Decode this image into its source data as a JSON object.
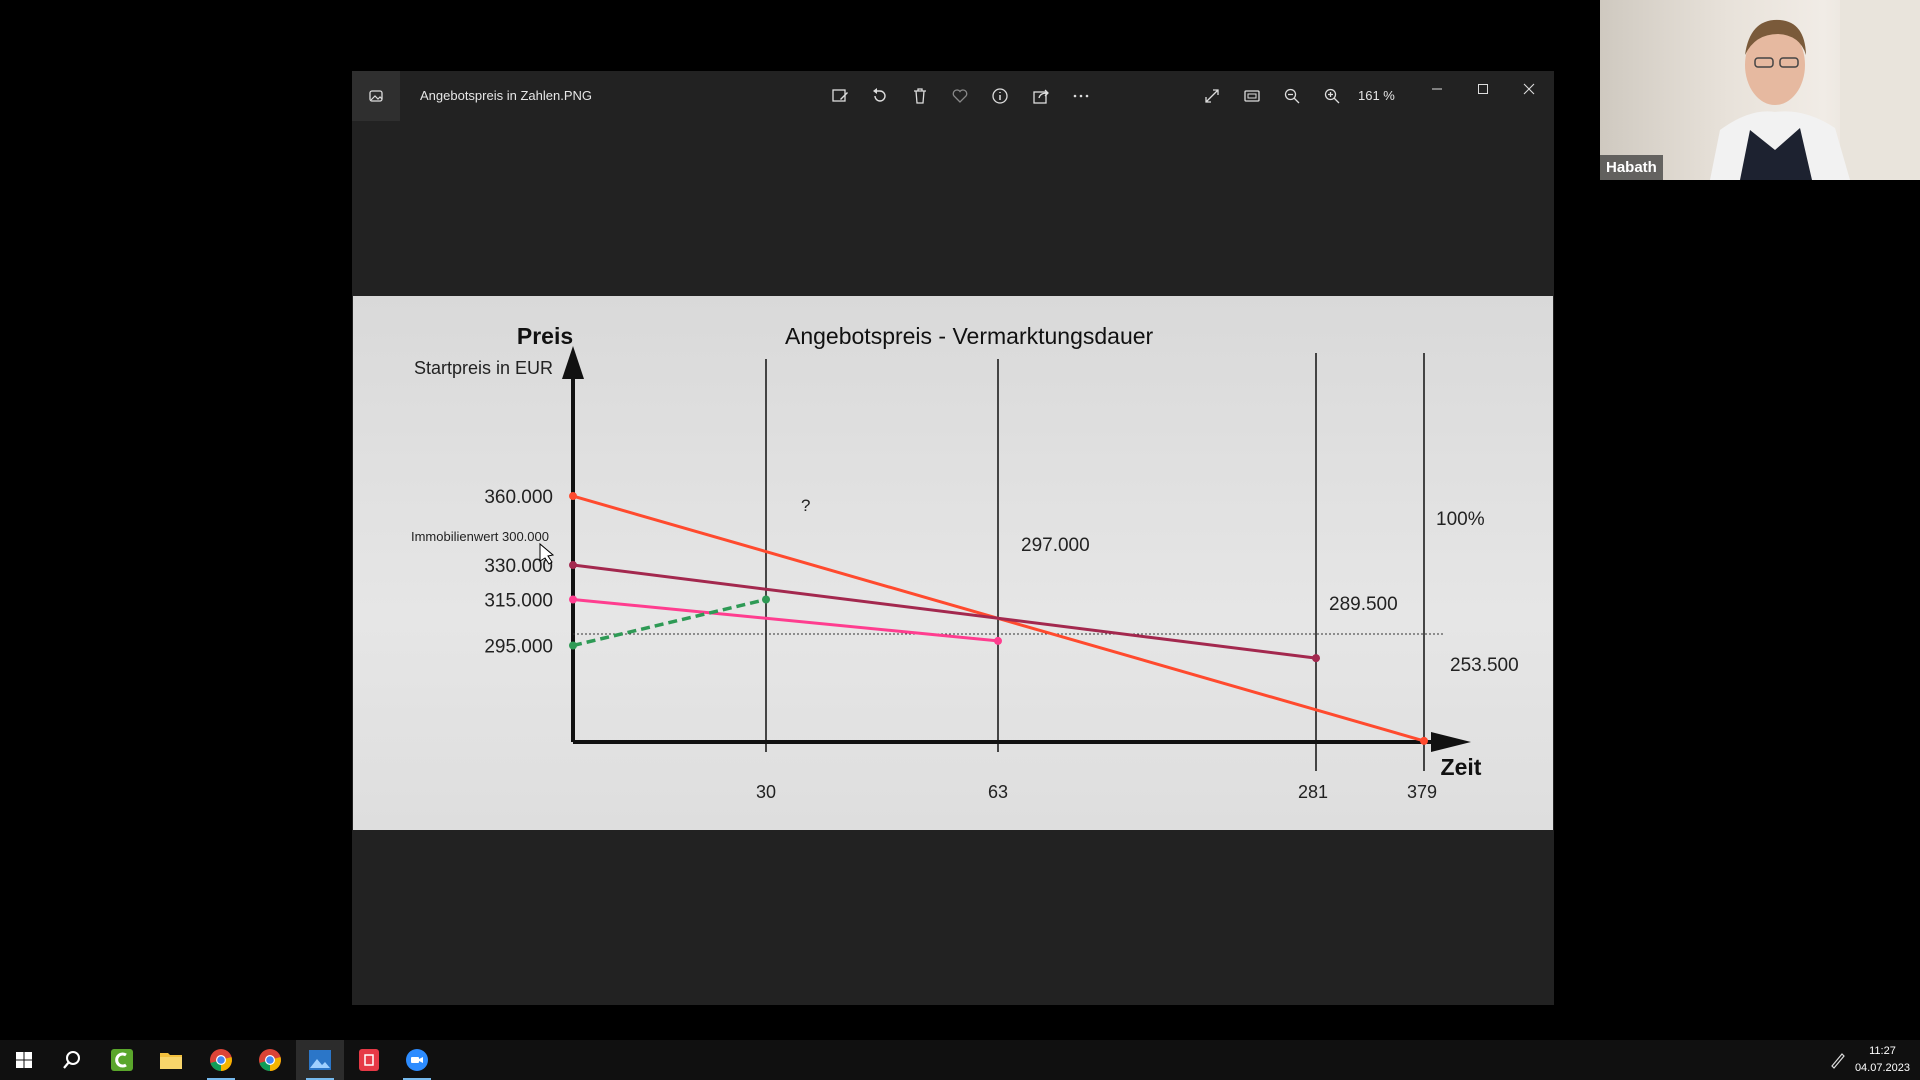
{
  "viewer": {
    "title": "Angebotspreis in Zahlen.PNG",
    "zoom": "161 %"
  },
  "chart_data": {
    "type": "line",
    "title": "Angebotspreis - Vermarktungsdauer",
    "ylabel": "Preis",
    "ysublabel": "Startpreis in EUR",
    "xlabel": "Zeit",
    "y_ticks": [
      "360.000",
      "330.000",
      "315.000",
      "295.000"
    ],
    "x_ticks": [
      "30",
      "63",
      "281",
      "379"
    ],
    "reference_line": {
      "label": "Immobilienwert 300.000",
      "value": 300000,
      "percent_label": "100%"
    },
    "series": [
      {
        "color": "#ff4a2e",
        "points": [
          [
            0,
            360000
          ],
          [
            379,
            253500
          ]
        ]
      },
      {
        "color": "#a3284e",
        "points": [
          [
            0,
            330000
          ],
          [
            281,
            289500
          ]
        ]
      },
      {
        "color": "#ff3d8f",
        "points": [
          [
            0,
            315000
          ],
          [
            63,
            297000
          ]
        ]
      },
      {
        "color": "#2e9a55",
        "dashed": true,
        "points": [
          [
            0,
            295000
          ],
          [
            30,
            315000
          ]
        ]
      }
    ],
    "annotations": [
      "?",
      "297.000",
      "289.500",
      "253.500"
    ]
  },
  "webcam": {
    "name": "Habath"
  },
  "taskbar": {
    "time": "11:27",
    "date": "04.07.2023",
    "apps": [
      "start-icon",
      "search-icon",
      "camtasia-icon",
      "file-explorer-icon",
      "chrome-icon",
      "chrome-icon",
      "photos-icon",
      "pdf-icon",
      "zoom-icon"
    ]
  }
}
